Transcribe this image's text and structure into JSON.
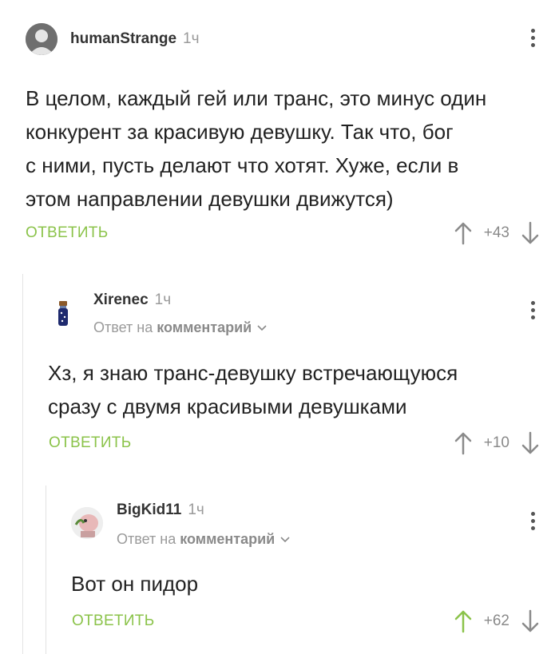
{
  "comments": [
    {
      "author": "humanStrange",
      "time": "1ч",
      "text_lines": [
        "В целом, каждый гей или транс, это минус один",
        "конкурент за красивую девушку. Так что, бог",
        "с ними, пусть делают что хотят. Хуже, если в",
        "этом направлении девушки движутся)"
      ],
      "reply_label": "ОТВЕТИТЬ",
      "score": "+43"
    },
    {
      "author": "Xirenec",
      "time": "1ч",
      "reply_prefix": "Ответ на",
      "reply_target": "комментарий",
      "text_lines": [
        "Хз, я знаю транс-девушку встречающуюся",
        "сразу с двумя красивыми девушками"
      ],
      "reply_label": "ОТВЕТИТЬ",
      "score": "+10"
    },
    {
      "author": "BigKid11",
      "time": "1ч",
      "reply_prefix": "Ответ на",
      "reply_target": "комментарий",
      "text_lines": [
        "Вот он пидор"
      ],
      "reply_label": "ОТВЕТИТЬ",
      "score": "+62",
      "upvoted": true
    }
  ],
  "colors": {
    "accent": "#8bc34a",
    "muted": "#9a9a9a",
    "upvoted": "#8bc34a",
    "arrow": "#8a8a8a"
  },
  "icons": {
    "menu": "kebab-icon",
    "upvote": "arrow-up-icon",
    "downvote": "arrow-down-icon",
    "expand": "chevron-down-icon"
  }
}
